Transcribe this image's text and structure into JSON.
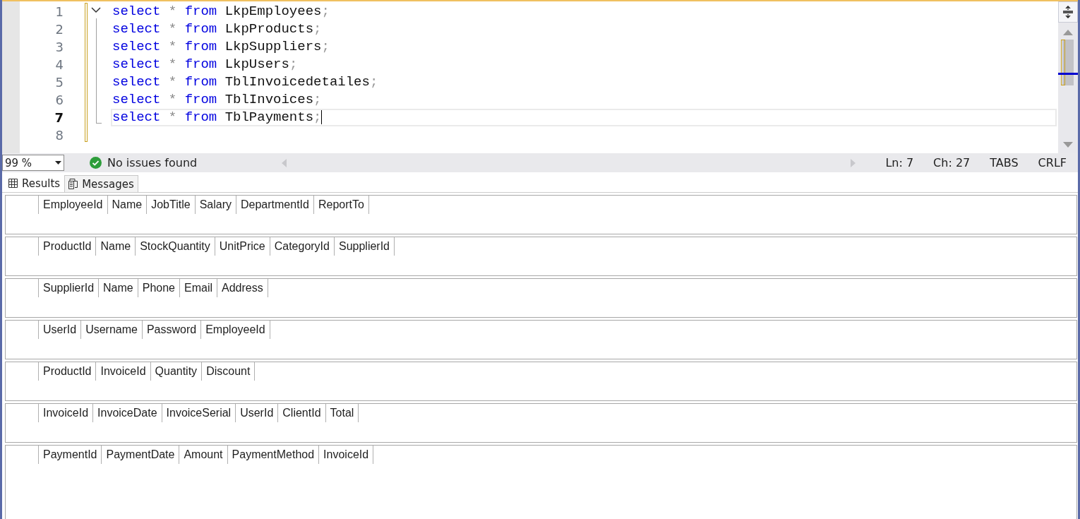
{
  "editor": {
    "fold_expanded": true,
    "lines": [
      {
        "number": "1",
        "select": "select",
        "star": "*",
        "from": "from",
        "table": "LkpEmployees",
        "end": ";",
        "current": false
      },
      {
        "number": "2",
        "select": "select",
        "star": "*",
        "from": "from",
        "table": "LkpProducts",
        "end": ";",
        "current": false
      },
      {
        "number": "3",
        "select": "select",
        "star": "*",
        "from": "from",
        "table": "LkpSuppliers",
        "end": ";",
        "current": false
      },
      {
        "number": "4",
        "select": "select",
        "star": "*",
        "from": "from",
        "table": "LkpUsers",
        "end": ";",
        "current": false
      },
      {
        "number": "5",
        "select": "select",
        "star": "*",
        "from": "from",
        "table": "TblInvoicedetailes",
        "end": ";",
        "current": false
      },
      {
        "number": "6",
        "select": "select",
        "star": "*",
        "from": "from",
        "table": "TblInvoices",
        "end": ";",
        "current": false
      },
      {
        "number": "7",
        "select": "select",
        "star": "*",
        "from": "from",
        "table": "TblPayments",
        "end": ";",
        "current": true
      },
      {
        "number": "8",
        "current": false
      }
    ]
  },
  "status_bar": {
    "zoom": "99 %",
    "issues": "No issues found",
    "line": "Ln: 7",
    "char": "Ch: 27",
    "indent": "TABS",
    "line_ending": "CRLF"
  },
  "tabs": [
    {
      "label": "Results",
      "selected": true
    },
    {
      "label": "Messages",
      "selected": false
    }
  ],
  "results": [
    {
      "columns": [
        "EmployeeId",
        "Name",
        "JobTitle",
        "Salary",
        "DepartmentId",
        "ReportTo"
      ]
    },
    {
      "columns": [
        "ProductId",
        "Name",
        "StockQuantity",
        "UnitPrice",
        "CategoryId",
        "SupplierId"
      ]
    },
    {
      "columns": [
        "SupplierId",
        "Name",
        "Phone",
        "Email",
        "Address"
      ]
    },
    {
      "columns": [
        "UserId",
        "Username",
        "Password",
        "EmployeeId"
      ]
    },
    {
      "columns": [
        "ProductId",
        "InvoiceId",
        "Quantity",
        "Discount"
      ]
    },
    {
      "columns": [
        "InvoiceId",
        "InvoiceDate",
        "InvoiceSerial",
        "UserId",
        "ClientId",
        "Total"
      ]
    },
    {
      "columns": [
        "PaymentId",
        "PaymentDate",
        "Amount",
        "PaymentMethod",
        "InvoiceId"
      ]
    }
  ]
}
